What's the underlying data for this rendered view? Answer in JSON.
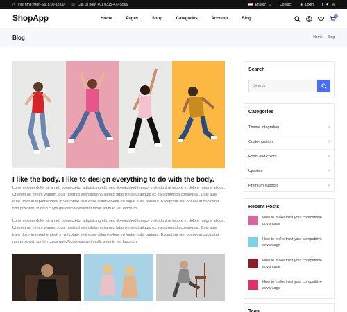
{
  "topbar": {
    "visit_time": "Visit time: Mon-Sat 8:00-18:00",
    "call": "Call us now: +01 0315-477-5566",
    "language": "English",
    "contact": "Contact",
    "login": "Login"
  },
  "navbar": {
    "logo": "ShopApp",
    "menu": [
      "Home",
      "Pages",
      "Shop",
      "Categories",
      "Account",
      "Blog"
    ],
    "cart_count": "0"
  },
  "page_header": {
    "title": "Blog",
    "breadcrumb": [
      "Home",
      "Blog"
    ]
  },
  "post": {
    "title": "I like the body. I like to design everything to do with the body.",
    "paragraph_1": "Lorem ipsum dolor sit amet, consectetur adipisicing elit, sed do eiusmod tempor incididunt ut labore et dolore magna aliqua. Ut enim ad minim veniam, quis nostrud exercitation ullamco laboris nisi ut aliquip ex ea commodo consequat. Duis aute irure dolor in reprehenderit in voluptate velit esse cillum dolore eu fugiat nulla pariatur. Excepteur sint occaecat cupidatat non proident, sunt in culpa qui officia deserunt mollit anim id est laborum.",
    "paragraph_2": "Lorem ipsum dolor sit amet, consectetur adipisicing elit, sed do eiusmod tempor incididunt ut labore et dolore magna aliqua. Ut enim ad minim veniam, quis nostrud exercitation ullamco laboris nisi ut aliquip ex ea commodo consequat. Duis aute irure dolor in reprehenderit in voluptate velit esse cillum dolore eu fugiat nulla pariatur. Excepteur sint occaecat cupidatat non proident, sunt in culpa qui officia deserunt mollit anim id est laborum."
  },
  "sidebar": {
    "search": {
      "title": "Search",
      "placeholder": "Search"
    },
    "categories": {
      "title": "Categories",
      "items": [
        "Theme integration",
        "Customization",
        "Fonts and colors",
        "Updates",
        "Premium support"
      ]
    },
    "recent_posts": {
      "title": "Recent Posts",
      "items": [
        "How to make trust your competitive advantage",
        "How to make trust your competitive advantage",
        "How to make trust your competitive advantage",
        "How to make trust your competitive advantage"
      ]
    },
    "tags": {
      "title": "Tags"
    }
  },
  "colors": {
    "accent": "#4a6cf7",
    "topbar_bg": "#111111",
    "header_bg": "#f4f7fb",
    "panel_gray": "#e9e9e7",
    "panel_pink": "#e9a2b0",
    "panel_yellow": "#fbb842"
  }
}
